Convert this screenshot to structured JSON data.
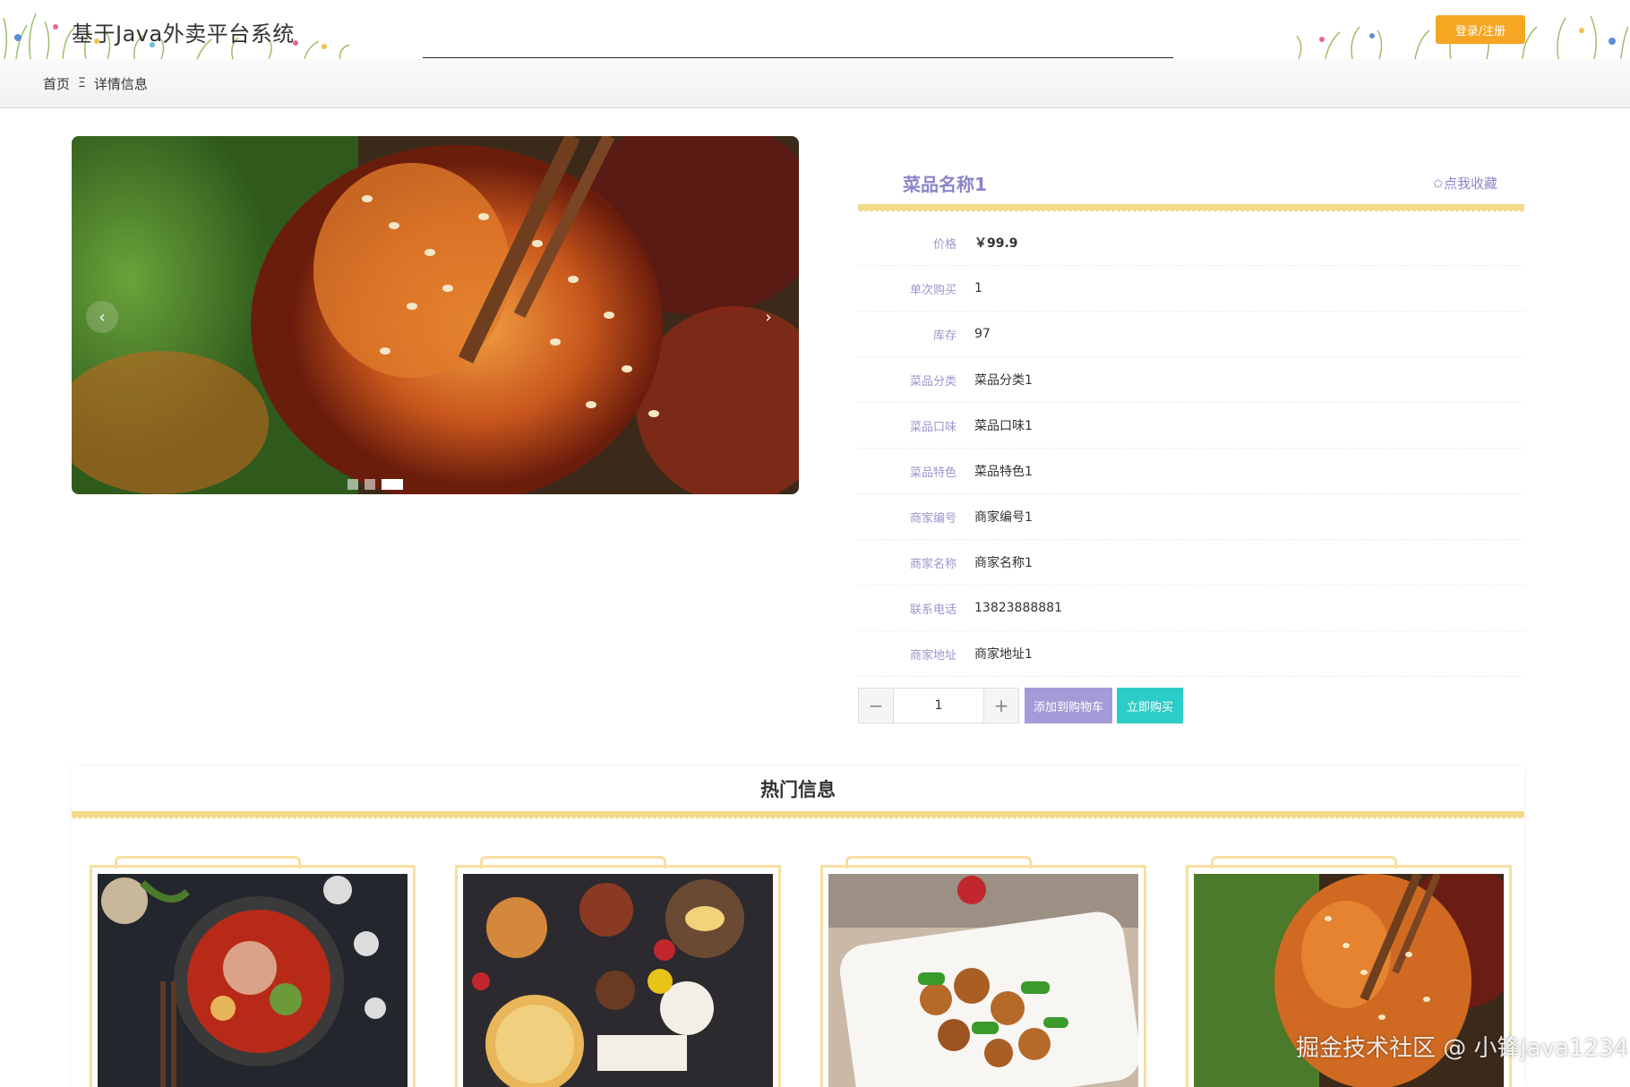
{
  "header": {
    "site_title": "基于Java外卖平台系统",
    "login_label": "登录/注册"
  },
  "breadcrumb": {
    "home": "首页",
    "separator": "Ξ",
    "current": "详情信息"
  },
  "carousel": {
    "prev_icon": "‹",
    "next_icon": "›",
    "slide_count": 3,
    "active_index": 2
  },
  "detail": {
    "name": "菜品名称1",
    "favorite_label": "✩点我收藏",
    "rows": [
      {
        "label": "价格",
        "value": "￥99.9"
      },
      {
        "label": "单次购买",
        "value": "1"
      },
      {
        "label": "库存",
        "value": "97"
      },
      {
        "label": "菜品分类",
        "value": "菜品分类1"
      },
      {
        "label": "菜品口味",
        "value": "菜品口味1"
      },
      {
        "label": "菜品特色",
        "value": "菜品特色1"
      },
      {
        "label": "商家编号",
        "value": "商家编号1"
      },
      {
        "label": "商家名称",
        "value": "商家名称1"
      },
      {
        "label": "联系电话",
        "value": "13823888881"
      },
      {
        "label": "商家地址",
        "value": "商家地址1"
      }
    ],
    "qty_minus": "−",
    "qty_value": "1",
    "qty_plus": "+",
    "add_cart_label": "添加到购物车",
    "buy_now_label": "立即购买"
  },
  "hot": {
    "title": "热门信息",
    "cards": [
      {
        "image": "hotpot-photo"
      },
      {
        "image": "feast-table-photo"
      },
      {
        "image": "stir-fry-photo"
      },
      {
        "image": "shrimp-photo"
      }
    ]
  },
  "watermark": "掘金技术社区 @ 小锋java1234",
  "colors": {
    "accent_purple": "#8b85c9",
    "login_orange": "#f5a623",
    "cart_purple": "#a29bd8",
    "buy_teal": "#2ccdc8",
    "wavy_yellow": "#f3d98a"
  }
}
